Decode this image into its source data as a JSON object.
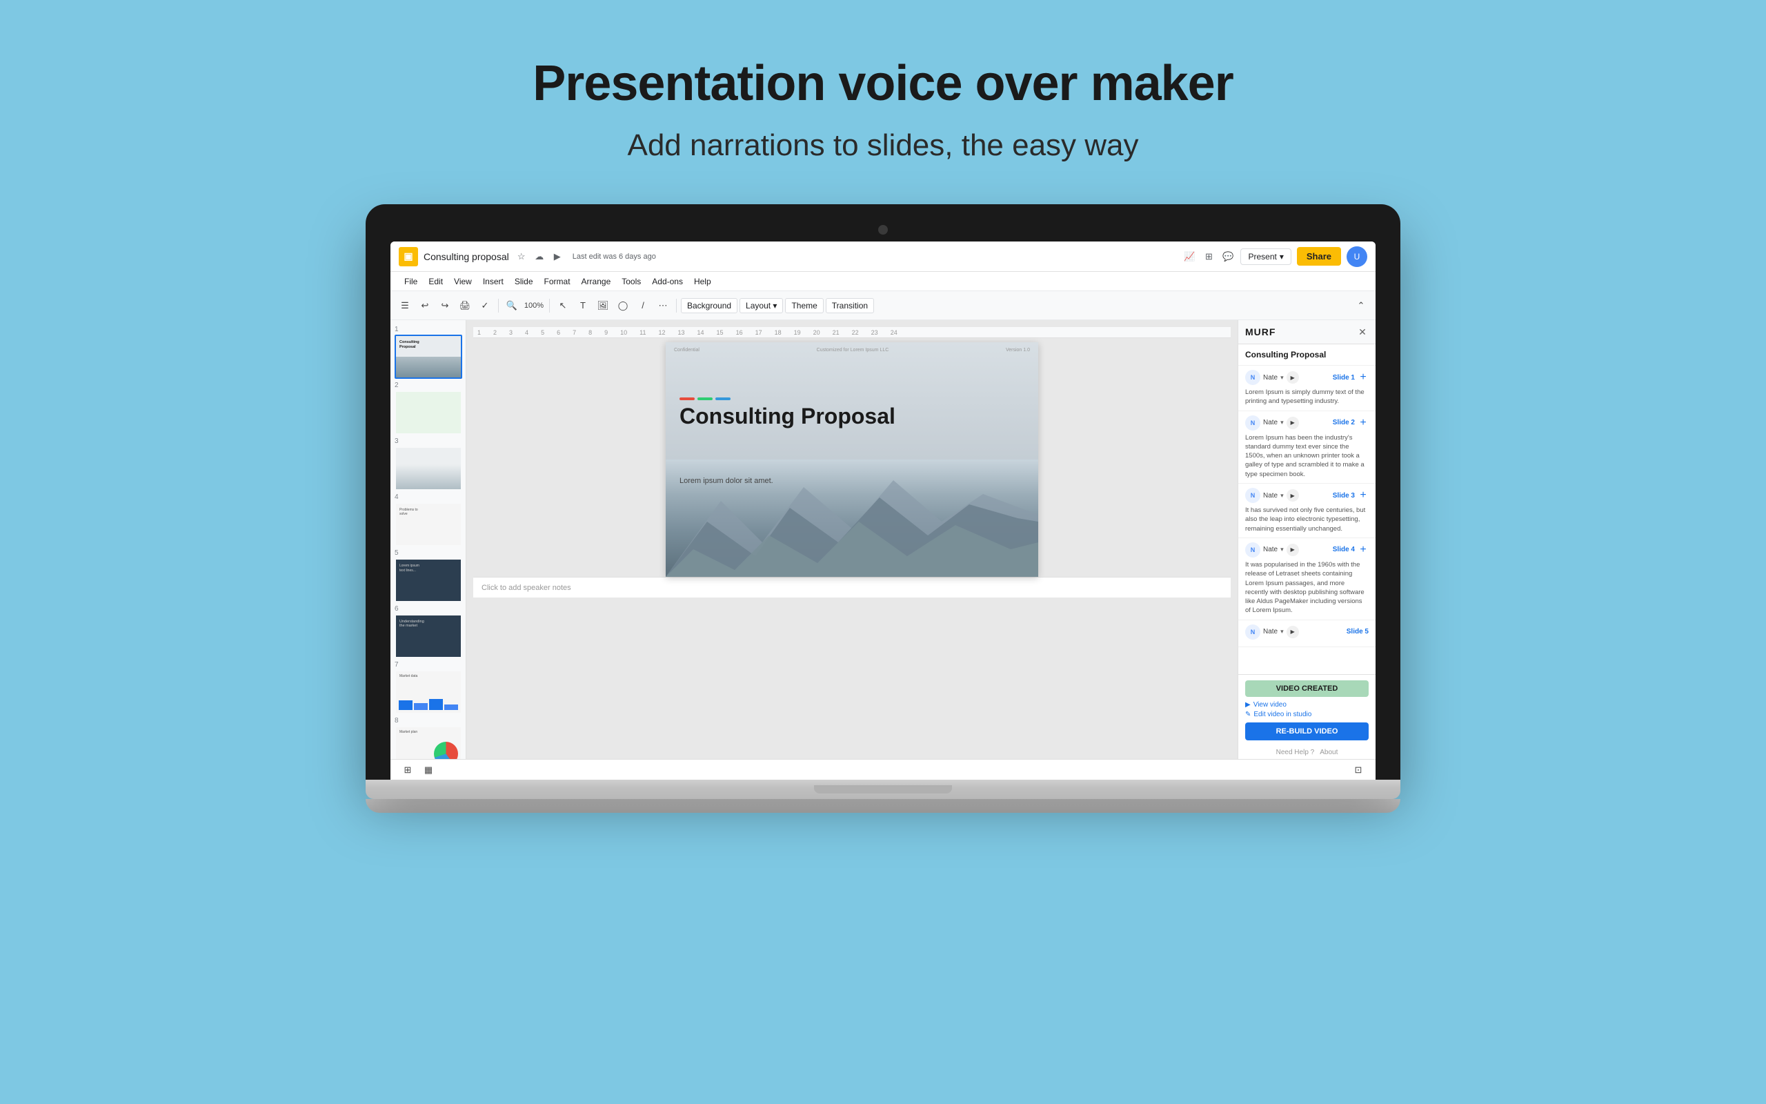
{
  "page": {
    "background_color": "#7ec8e3",
    "title": "Presentation voice over maker",
    "subtitle": "Add narrations to slides, the easy way"
  },
  "slides_app": {
    "doc_title": "Consulting proposal",
    "last_edit": "Last edit was 6 days ago",
    "menu_items": [
      "File",
      "Edit",
      "View",
      "Insert",
      "Slide",
      "Format",
      "Arrange",
      "Tools",
      "Add-ons",
      "Help"
    ],
    "toolbar_labels": [
      "Background",
      "Layout",
      "Theme",
      "Transition"
    ],
    "present_label": "Present",
    "share_label": "Share"
  },
  "murf": {
    "logo": "MURF",
    "title": "Consulting Proposal",
    "slides": [
      {
        "voice": "Nate",
        "slide_label": "Slide 1",
        "text": "Lorem Ipsum is simply dummy text of the printing and typesetting industry."
      },
      {
        "voice": "Nate",
        "slide_label": "Slide 2",
        "text": "Lorem Ipsum has been the industry's standard dummy text ever since the 1500s, when an unknown printer took a galley of type and scrambled it to make a type specimen book."
      },
      {
        "voice": "Nate",
        "slide_label": "Slide 3",
        "text": "It has survived not only five centuries, but also the leap into electronic typesetting, remaining essentially unchanged."
      },
      {
        "voice": "Nate",
        "slide_label": "Slide 4",
        "text": "It was popularised in the 1960s with the release of Letraset sheets containing Lorem Ipsum passages, and more recently with desktop publishing software like Aldus PageMaker including versions of Lorem Ipsum."
      },
      {
        "voice": "Nate",
        "slide_label": "Slide 5",
        "text": ""
      }
    ],
    "video_created_label": "VIDEO CREATED",
    "view_video_label": "View video",
    "edit_video_label": "Edit video in studio",
    "rebuild_label": "RE-BUILD VIDEO",
    "footer_items": [
      "Need Help ?",
      "About"
    ]
  },
  "main_slide": {
    "confidential_text": "Confidential",
    "customized_for": "Customized for Lorem Ipsum LLC",
    "version": "Version 1.0",
    "title": "Consulting Proposal",
    "subtitle": "Lorem ipsum dolor sit amet.",
    "accent_colors": [
      "#e74c3c",
      "#2ecc71",
      "#3498db"
    ]
  },
  "speaker_notes": "Click to add speaker notes"
}
